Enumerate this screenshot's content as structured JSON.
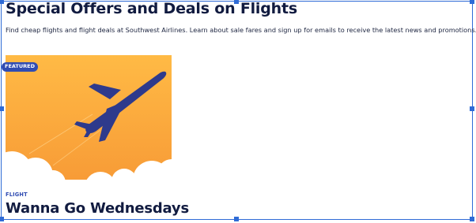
{
  "page": {
    "title": "Special Offers and Deals on Flights",
    "description": "Find cheap flights and flight deals at Southwest Airlines. Learn about sale fares and sign up for emails to receive the latest news and promotions."
  },
  "card": {
    "badge": "FEATURED",
    "kicker": "FLIGHT",
    "title": "Wanna Go Wednesdays",
    "image_icon": "airplane-illustration"
  },
  "colors": {
    "heading": "#111b40",
    "accent": "#304cb2",
    "image_orange": "#f9a63a",
    "selection": "#2f6bd6"
  }
}
